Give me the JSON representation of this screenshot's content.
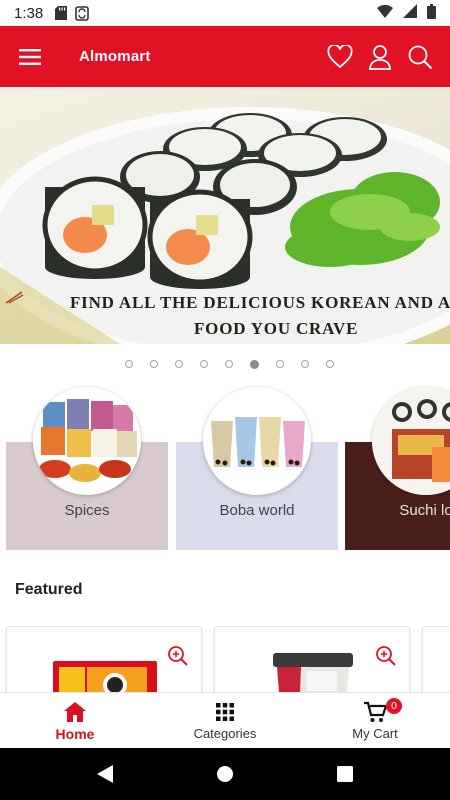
{
  "status_bar": {
    "time": "1:38",
    "icons": [
      "sd-card-icon",
      "sync-icon",
      "wifi-icon",
      "signal-icon",
      "battery-icon"
    ]
  },
  "app_bar": {
    "title": "Almomart",
    "menu_icon": "hamburger-menu-icon",
    "actions": [
      "heart-icon",
      "user-icon",
      "search-icon"
    ],
    "color": "#e11226"
  },
  "banner": {
    "caption_line1": "FIND ALL THE DELICIOUS KOREAN AND A",
    "caption_line2": "FOOD YOU CRAVE",
    "slide_count": 9,
    "active_slide": 6
  },
  "categories": [
    {
      "label": "Spices",
      "card_color": "#d9cbcd",
      "image": "spice-packets"
    },
    {
      "label": "Boba world",
      "card_color": "#dadbeb",
      "image": "boba-cups"
    },
    {
      "label": "Suchi lo",
      "card_color": "#4a1f1a",
      "image": "sushi-pack"
    }
  ],
  "featured": {
    "title": "Featured",
    "products": [
      {
        "image": "ramen-noodle-pack",
        "zoom_icon": "zoom-in-icon"
      },
      {
        "image": "cup-drink",
        "zoom_icon": "zoom-in-icon"
      }
    ]
  },
  "bottom_nav": {
    "items": [
      {
        "label": "Home",
        "icon": "home-icon",
        "active": true
      },
      {
        "label": "Categories",
        "icon": "grid-icon",
        "active": false
      },
      {
        "label": "My Cart",
        "icon": "cart-icon",
        "active": false,
        "badge": "0"
      }
    ],
    "active_color": "#d9101f"
  },
  "system_nav": [
    "back-icon",
    "home-circle-icon",
    "recents-icon"
  ]
}
